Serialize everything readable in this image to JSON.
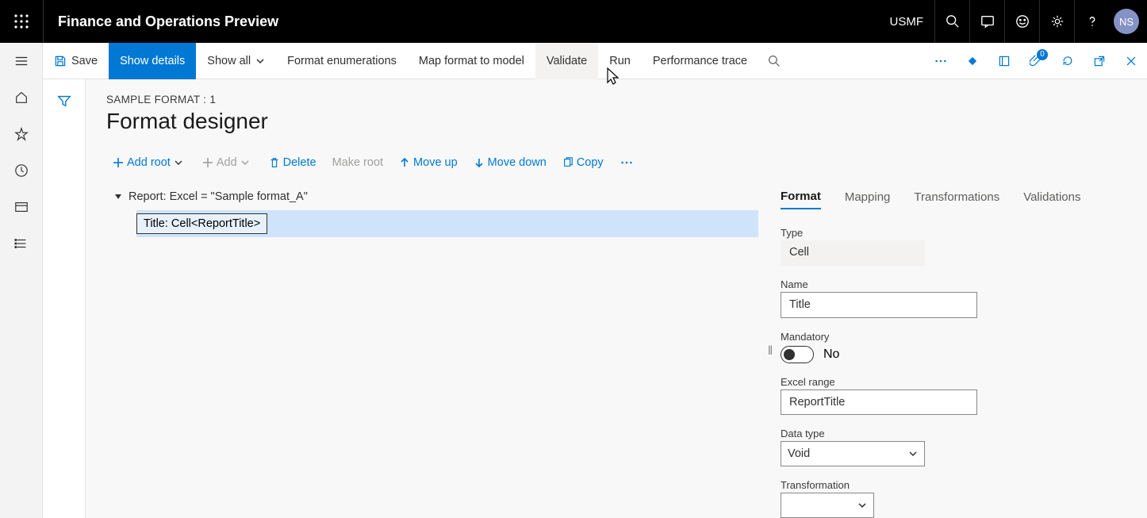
{
  "topbar": {
    "app_title": "Finance and Operations Preview",
    "company": "USMF",
    "avatar_initials": "NS"
  },
  "cmdbar": {
    "save": "Save",
    "show_details": "Show details",
    "show_all": "Show all",
    "format_enum": "Format enumerations",
    "map_format": "Map format to model",
    "validate": "Validate",
    "run": "Run",
    "perf_trace": "Performance trace",
    "badge_count": "0"
  },
  "page": {
    "crumb": "SAMPLE FORMAT : 1",
    "title": "Format designer"
  },
  "toolbar": {
    "add_root": "Add root",
    "add": "Add",
    "delete": "Delete",
    "make_root": "Make root",
    "move_up": "Move up",
    "move_down": "Move down",
    "copy": "Copy"
  },
  "tree": {
    "root": "Report: Excel = \"Sample format_A\"",
    "child": "Title: Cell<ReportTitle>"
  },
  "ptabs": {
    "format": "Format",
    "mapping": "Mapping",
    "transformations": "Transformations",
    "validations": "Validations"
  },
  "props": {
    "type_label": "Type",
    "type_value": "Cell",
    "name_label": "Name",
    "name_value": "Title",
    "mandatory_label": "Mandatory",
    "mandatory_value": "No",
    "excel_range_label": "Excel range",
    "excel_range_value": "ReportTitle",
    "data_type_label": "Data type",
    "data_type_value": "Void",
    "transformation_label": "Transformation",
    "transformation_value": ""
  }
}
